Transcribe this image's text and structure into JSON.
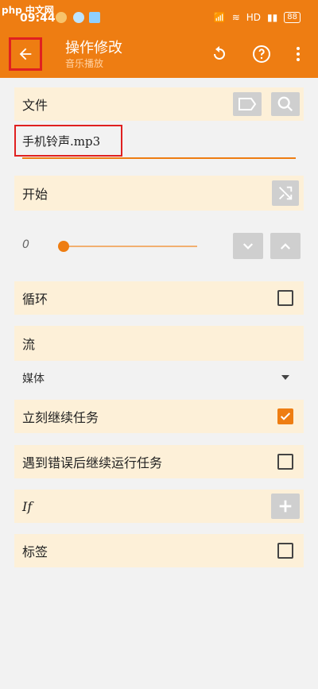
{
  "status_bar": {
    "watermark": "php 中文网",
    "time": "09:44",
    "network": "HD",
    "battery": "88"
  },
  "header": {
    "title": "操作修改",
    "subtitle": "音乐播放"
  },
  "form": {
    "file_label": "文件",
    "file_value": "手机铃声.mp3",
    "start_label": "开始",
    "volume_value": "0",
    "loop_label": "循环",
    "stream_label": "流",
    "stream_value": "媒体",
    "continue_label": "立刻继续任务",
    "continue_checked": true,
    "error_continue_label": "遇到错误后继续运行任务",
    "if_label": "If",
    "tag_label": "标签"
  },
  "colors": {
    "accent": "#ee7d12",
    "row_bg": "#fdf0d8",
    "highlight_box": "#e02020"
  }
}
